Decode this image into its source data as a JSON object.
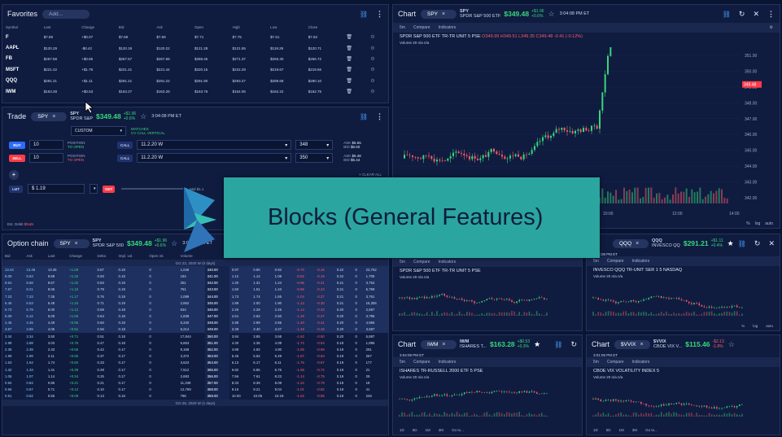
{
  "favorites": {
    "title": "Favorites",
    "add_label": "Add...",
    "columns": [
      "Symbol",
      "Last",
      "Change",
      "Bid",
      "Ask",
      "Open",
      "High",
      "Low",
      "Close"
    ],
    "rows": [
      {
        "symbol": "F",
        "last": "$7.69",
        "change": "+$0.07",
        "bid": "$7.68",
        "ask": "$7.69",
        "open": "$7.71",
        "high": "$7.75",
        "low": "$7.61",
        "close": "$7.62",
        "dir": "up"
      },
      {
        "symbol": "AAPL",
        "last": "$120.29",
        "change": "-$0.42",
        "bid": "$120.19",
        "ask": "$120.22",
        "open": "$121.28",
        "high": "$121.55",
        "low": "$119.29",
        "close": "$120.71",
        "dir": "dn"
      },
      {
        "symbol": "FB",
        "last": "$267.58",
        "change": "+$0.86",
        "bid": "$267.57",
        "ask": "$267.58",
        "open": "$268.45",
        "high": "$271.37",
        "low": "$265.30",
        "close": "$266.72",
        "dir": "up"
      },
      {
        "symbol": "MSFT",
        "last": "$221.42",
        "change": "+$1.76",
        "bid": "$221.41",
        "ask": "$221.44",
        "open": "$220.15",
        "high": "$222.29",
        "low": "$219.67",
        "close": "$219.66",
        "dir": "up"
      },
      {
        "symbol": "QQQ",
        "last": "$291.21",
        "change": "+$1.11",
        "bid": "$291.21",
        "ask": "$291.22",
        "open": "$291.80",
        "high": "$293.27",
        "low": "$289.68",
        "close": "$290.10",
        "dir": "up"
      },
      {
        "symbol": "IWM",
        "last": "$163.28",
        "change": "+$0.53",
        "bid": "$163.27",
        "ask": "$163.29",
        "open": "$163.76",
        "high": "$164.06",
        "low": "$162.22",
        "close": "$162.75",
        "dir": "up"
      }
    ]
  },
  "trade": {
    "title": "Trade",
    "symbol": "SPY",
    "sym_name": "SPY",
    "sym_desc": "SPDR S&P",
    "price": "$349.48",
    "chg1": "+$1.96",
    "chg2": "+0.6%",
    "time": "3:04:08 PM ET",
    "strategy": "CUSTOM",
    "matches1": "MATCHES",
    "matches2": "CV CALL VERTICAL",
    "legs": [
      {
        "side": "BUY",
        "qty": "10",
        "pos1": "POSITION",
        "pos2": "TO OPEN",
        "type": "CALL",
        "exp": "11.2.20 W",
        "strike": "348",
        "ask_l": "ASK",
        "ask": "$6.55",
        "bid_l": "BID",
        "bid": "$6.50"
      },
      {
        "side": "SELL",
        "qty": "10",
        "pos1": "POSITION",
        "pos2": "TO OPEN",
        "type": "CALL",
        "exp": "11.2.20 W",
        "strike": "350",
        "ask_l": "ASK",
        "ask": "$5.48",
        "bid_l": "BID",
        "bid": "$5.44"
      }
    ],
    "clear_all": "× CLEAR ALL",
    "order_type": "LMT",
    "limit": "$ 1.19",
    "tif": "GET",
    "est_label": "Est. Debit",
    "est_value": "$NaN",
    "mid_label": "Mid",
    "mid_value": "$1.1"
  },
  "option_chain": {
    "title": "Option chain",
    "symbol": "SPY",
    "sym_name": "SPY",
    "sym_desc": "SPDR S&P 500",
    "price": "$349.48",
    "chg1": "+$1.96",
    "chg2": "+0.6%",
    "time": "3:04:08 PM ET",
    "columns": [
      "Bid",
      "Ask",
      "Last",
      "Change",
      "Delta",
      "Impl. vol.",
      "Open int.",
      "Volume",
      "",
      "",
      "",
      "",
      "",
      "",
      "",
      "",
      ""
    ],
    "exp_top": "Oct 23, 2020 W (0 days)",
    "exp_bottom": "Oct 26, 2020 W (1 days)",
    "rows": [
      [
        "13.44",
        "13.48",
        "13.45",
        "+1.28",
        "0.87",
        "0.19",
        "0",
        "1,046",
        "340.00",
        "0.97",
        "0.90",
        "0.92",
        "-0.70",
        "-0.16",
        "0.22",
        "0",
        "23,752"
      ],
      [
        "9.09",
        "9.63",
        "9.69",
        "+1.32",
        "0.93",
        "0.19",
        "0",
        "194",
        "341.00",
        "1.12",
        "1.14",
        "1.08",
        "-0.82",
        "-0.19",
        "0.22",
        "0",
        "1,705"
      ],
      [
        "8.64",
        "8.68",
        "8.67",
        "+1.32",
        "0.83",
        "0.19",
        "0",
        "251",
        "342.00",
        "1.30",
        "1.31",
        "1.24",
        "-0.96",
        "-0.21",
        "0.21",
        "0",
        "3,754"
      ],
      [
        "7.67",
        "8.21",
        "8.05",
        "+1.15",
        "0.79",
        "0.19",
        "0",
        "761",
        "343.00",
        "1.50",
        "1.51",
        "1.43",
        "-0.86",
        "-0.24",
        "0.21",
        "0",
        "5,769"
      ],
      [
        "7.23",
        "7.23",
        "7.35",
        "+1.17",
        "0.76",
        "0.19",
        "0",
        "1,089",
        "344.00",
        "1.73",
        "1.74",
        "1.65",
        "-1.04",
        "-0.27",
        "0.21",
        "0",
        "3,761"
      ],
      [
        "6.46",
        "6.53",
        "6.48",
        "+1.15",
        "0.71",
        "0.19",
        "0",
        "2,652",
        "345.00",
        "1.99",
        "2.00",
        "1.90",
        "-1.12",
        "-0.30",
        "0.21",
        "0",
        "15,355"
      ],
      [
        "5.73",
        "5.79",
        "6.00",
        "+1.12",
        "0.69",
        "0.18",
        "0",
        "634",
        "346.00",
        "2.26",
        "2.29",
        "2.25",
        "-1.14",
        "-0.33",
        "0.20",
        "0",
        "2,597"
      ],
      [
        "5.08",
        "5.12",
        "5.09",
        "+1.06",
        "0.64",
        "0.18",
        "0",
        "1,839",
        "347.00",
        "2.61",
        "2.62",
        "2.50",
        "-1.26",
        "-0.37",
        "0.20",
        "0",
        "3,795"
      ],
      [
        "4.45",
        "4.45",
        "4.49",
        "+0.96",
        "0.60",
        "0.18",
        "0",
        "6,340",
        "348.00",
        "2.98",
        "2.99",
        "2.85",
        "-1.40",
        "-0.41",
        "0.20",
        "0",
        "4,956"
      ],
      [
        "3.87",
        "3.89",
        "4.05",
        "+0.91",
        "0.56",
        "0.18",
        "0",
        "6,214",
        "349.00",
        "3.39",
        "3.40",
        "3.27",
        "-1.48",
        "-0.45",
        "0.20",
        "0",
        "3,687"
      ],
      [
        "3.34",
        "3.34",
        "3.50",
        "+0.71",
        "0.51",
        "0.18",
        "0",
        "17,844",
        "350.00",
        "3.84",
        "3.85",
        "3.68",
        "-1.62",
        "-0.50",
        "0.20",
        "0",
        "5,887"
      ],
      [
        "2.88",
        "2.88",
        "3.03",
        "+0.76",
        "0.47",
        "0.18",
        "0",
        "6,663",
        "351.00",
        "4.30",
        "4.35",
        "4.08",
        "-1.72",
        "-0.54",
        "0.19",
        "0",
        "1,895"
      ],
      [
        "2.38",
        "2.39",
        "2.33",
        "+0.55",
        "0.42",
        "0.17",
        "0",
        "9,168",
        "352.00",
        "4.89",
        "4.92",
        "4.90",
        "-1.65",
        "-0.59",
        "0.19",
        "0",
        "291"
      ],
      [
        "1.98",
        "1.99",
        "2.11",
        "+0.56",
        "0.37",
        "0.17",
        "0",
        "3,372",
        "353.00",
        "5.46",
        "5.52",
        "5.49",
        "-1.67",
        "-0.63",
        "0.19",
        "0",
        "267"
      ],
      [
        "1.63",
        "1.64",
        "1.74",
        "+0.50",
        "0.33",
        "0.17",
        "0",
        "3,623",
        "354.00",
        "6.13",
        "6.17",
        "6.11",
        "-1.75",
        "-0.67",
        "0.19",
        "0",
        "177"
      ],
      [
        "1.32",
        "1.33",
        "1.41",
        "+0.39",
        "0.28",
        "0.17",
        "0",
        "7,512",
        "355.00",
        "6.82",
        "6.86",
        "6.76",
        "-1.68",
        "-0.72",
        "0.19",
        "0",
        "21"
      ],
      [
        "1.06",
        "1.07",
        "1.14",
        "+0.34",
        "0.25",
        "0.17",
        "0",
        "2,693",
        "356.00",
        "7.56",
        "7.61",
        "8.23",
        "-1.14",
        "-0.75",
        "0.19",
        "0",
        "29"
      ],
      [
        "0.84",
        "0.84",
        "0.86",
        "+0.21",
        "0.21",
        "0.17",
        "0",
        "11,339",
        "357.00",
        "8.33",
        "8.39",
        "8.08",
        "-1.22",
        "-0.79",
        "0.19",
        "0",
        "18"
      ],
      [
        "0.66",
        "0.67",
        "0.71",
        "+0.12",
        "0.10",
        "0.17",
        "0",
        "12,789",
        "358.00",
        "9.16",
        "9.21",
        "9.04",
        "-1.01",
        "-0.82",
        "0.19",
        "0",
        "41"
      ],
      [
        "0.51",
        "0.52",
        "0.55",
        "+0.09",
        "0.13",
        "0.16",
        "0",
        "796",
        "359.00",
        "10.00",
        "10.06",
        "10.19",
        "-1.02",
        "-0.85",
        "0.19",
        "0",
        "246"
      ]
    ]
  },
  "main_chart": {
    "title": "Chart",
    "symbol": "SPY",
    "sym_name": "SPY",
    "sym_desc": "SPDR S&P 500 ETF",
    "price": "$349.48",
    "chg1": "+$1.96",
    "chg2": "+0.6%",
    "time": "3:04:08 PM ET",
    "toolbar": [
      "5m",
      "Compare",
      "Indicators"
    ],
    "label": "SPDR S&P 500 ETF TR-TR UNIT  5  PSE",
    "ohlc": "O349.99 H349.51 L349.35 C349.48 -0.41 (-0.12%)",
    "volume": "Volume  20  n/a  n/a",
    "yticks": [
      "351.00",
      "350.00",
      "349.00",
      "348.00",
      "347.00",
      "346.00",
      "345.00",
      "344.00",
      "343.00",
      "342.00"
    ],
    "last_tag": "349.48",
    "xticks": [
      "16",
      "10:00",
      "12:00",
      "14:00"
    ],
    "bottom": [
      "1D",
      "5D",
      "1M",
      "3M",
      "6M",
      "YTD",
      "1Y",
      "5Y",
      "All",
      "Go to..."
    ],
    "scale": [
      "%",
      "log",
      "auto"
    ]
  },
  "qqq_chart": {
    "title": "Chart",
    "symbol": "QQQ",
    "sym_name": "QQQ",
    "sym_desc": "INVESCO QQ",
    "price": "$291.21",
    "chg1": "+$1.11",
    "chg2": "+0.4%",
    "time": "3:04:08 PM ET",
    "toolbar": [
      "5m",
      "Compare",
      "Indicators"
    ],
    "label": "INVESCO QQQ TR-UNIT SER 1  5  NASDAQ",
    "ohlc": "O291.26 H291.30 L291.20 C291.21 -0.41 (-0.12%)",
    "volume": "Volume  20  n/a  n/a",
    "xticks": [
      "13:30",
      "16",
      "14:30"
    ],
    "ylast": "291.21",
    "bottom": [
      "1D",
      "5D",
      "1M",
      "3M",
      "6M",
      "YTD",
      "1Y",
      "5Y",
      "All",
      "Go to..."
    ],
    "scale": [
      "%",
      "log",
      "auto"
    ]
  },
  "spy2_chart": {
    "label": "SPDR S&P 500 ETF TR-TR UNIT  5  PSE",
    "volume": "Volume  20  n/a  n/a",
    "xticks": [
      "13:30",
      "16",
      "14:30"
    ],
    "toolbar": [
      "5m",
      "Compare",
      "Indicators"
    ],
    "bottom": [
      "1D",
      "5D",
      "1M",
      "3M",
      "6M",
      "YTD",
      "1Y",
      "5Y",
      "All",
      "Go to..."
    ],
    "scale": [
      "%",
      "log",
      "auto"
    ]
  },
  "iwm_chart": {
    "title": "Chart",
    "symbol": "IWM",
    "sym_name": "IWM",
    "sym_desc": "ISHARES T...",
    "price": "$163.28",
    "chg1": "+$0.53",
    "chg2": "+0.3%",
    "time": "3:04:08 PM ET",
    "toolbar": [
      "5m",
      "Compare",
      "Indicators"
    ],
    "label": "ISHARES TR-RUSSELL 2000 ETF  5  PSE",
    "ohlc": "O163.35 H163.37 L163.26 C163.28",
    "volume": "Volume  20  n/a  n/a",
    "xticks": [
      "13:30",
      "16",
      "14:30"
    ],
    "bottom": [
      "1D",
      "5D",
      "1M",
      "3M",
      "6M",
      "YTD",
      "1Y",
      "5Y",
      "All",
      "Go to..."
    ],
    "scale": [
      "%",
      "log",
      "auto"
    ]
  },
  "vix_chart": {
    "title": "Chart",
    "symbol": "$VVIX",
    "sym_name": "$VVIX",
    "sym_desc": "CBOE VIX V...",
    "price": "$115.46",
    "chg1": "-$2.13",
    "chg2": "-1.8%",
    "time": "3:01:06 PM ET",
    "toolbar": [
      "5m",
      "Compare",
      "Indicators"
    ],
    "label": "CBOE VIX VOLATILITY INDEX  5",
    "volume": "Volume  20  n/a  n/a",
    "xticks": [
      "13:30",
      "16",
      "14:30"
    ],
    "bottom": [
      "1D",
      "5D",
      "1M",
      "3M",
      "6M",
      "YTD",
      "1Y",
      "5Y",
      "All",
      "Go to..."
    ],
    "scale": [
      "%",
      "log",
      "auto"
    ]
  },
  "banner": {
    "text": "Blocks (General Features)"
  },
  "colors": {
    "bg": "#0a1533",
    "panel": "#0f1c40",
    "accent": "#4aa3ff",
    "up": "#39d67a",
    "down": "#ff5b6a",
    "banner": "#2aa5a0"
  }
}
